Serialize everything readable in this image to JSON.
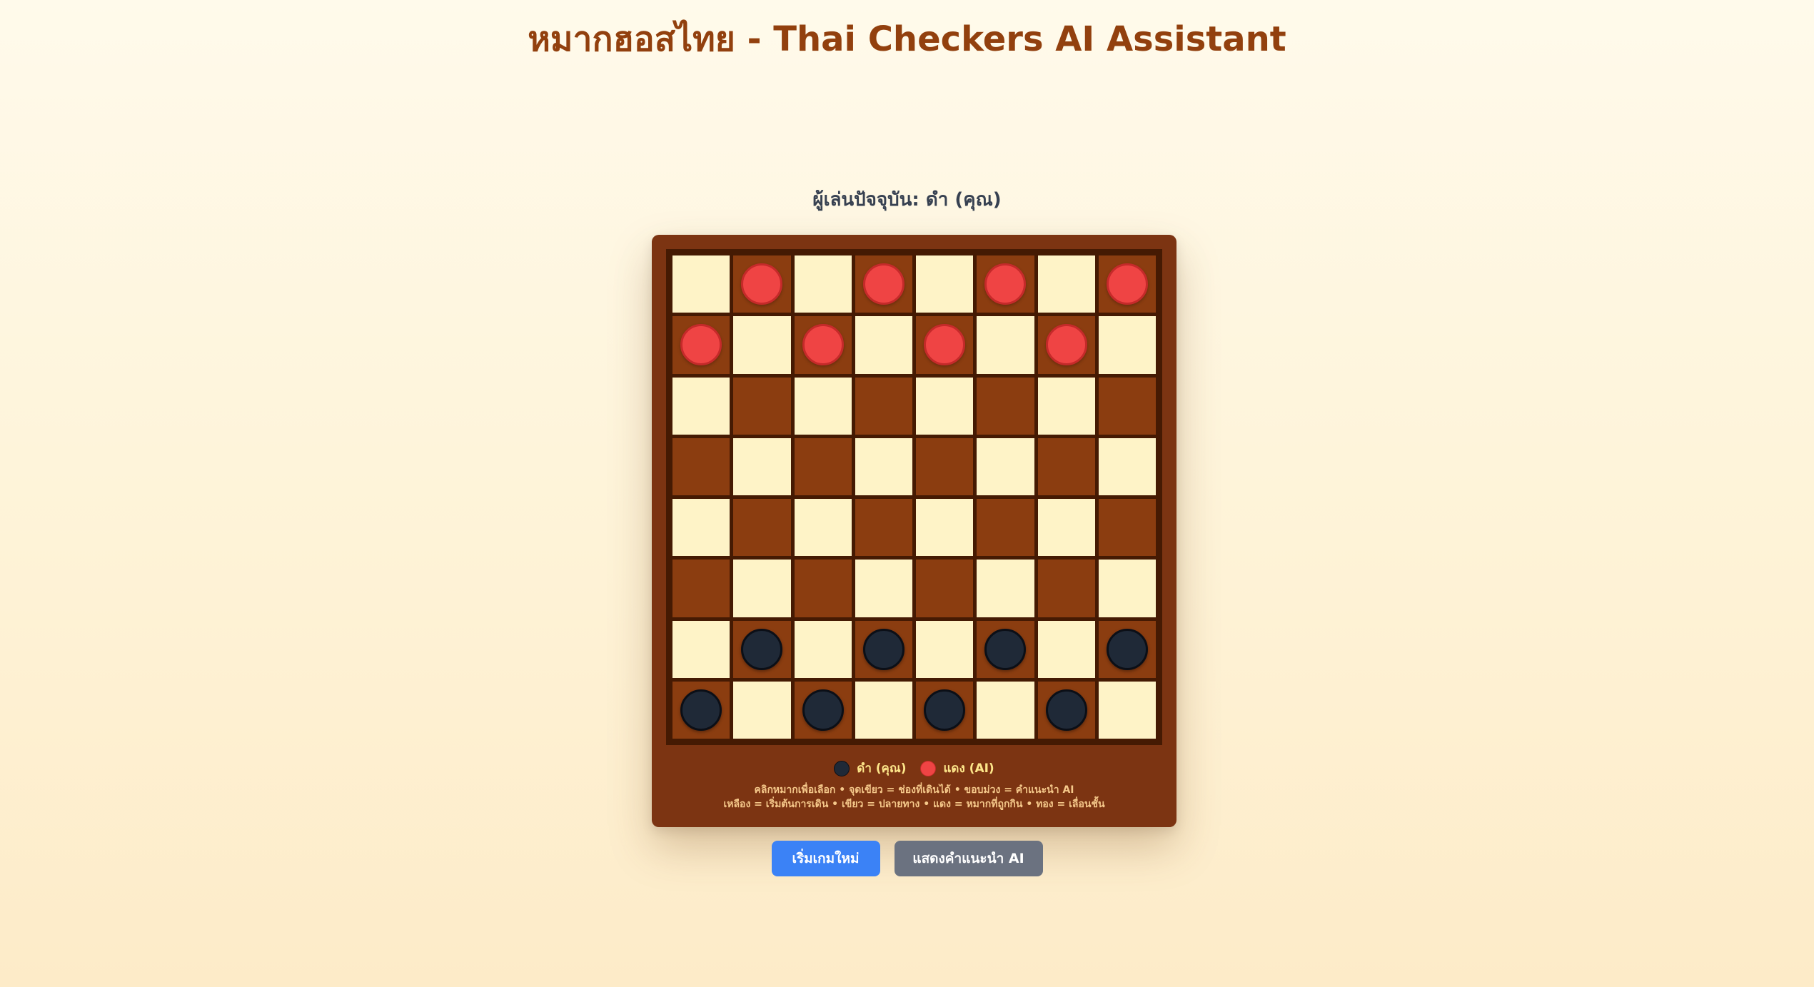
{
  "title": "หมากฮอสไทย - Thai Checkers AI Assistant",
  "current_player": "ผู้เล่นปัจจุบัน: ดำ (คุณ)",
  "board": {
    "size": 8,
    "colors": {
      "light": "#fef3c7",
      "dark": "#8b3d10",
      "red_piece": "#ef4444",
      "black_piece": "#1f2937"
    },
    "rows": [
      ".r.r.r.r",
      "r.r.r.r.",
      "........",
      "........",
      "........",
      "........",
      ".b.b.b.b",
      "b.b.b.b."
    ]
  },
  "legend": {
    "black_label": "ดำ (คุณ)",
    "red_label": "แดง (AI)"
  },
  "help": {
    "line1": "คลิกหมากเพื่อเลือก • จุดเขียว = ช่องที่เดินได้ • ขอบม่วง = คำแนะนำ AI",
    "line2": "เหลือง = เริ่มต้นการเดิน • เขียว = ปลายทาง • แดง = หมากที่ถูกกิน • ทอง = เลื่อนชั้น"
  },
  "buttons": {
    "new_game": "เริ่มเกมใหม่",
    "show_ai_hint": "แสดงคำแนะนำ AI"
  }
}
